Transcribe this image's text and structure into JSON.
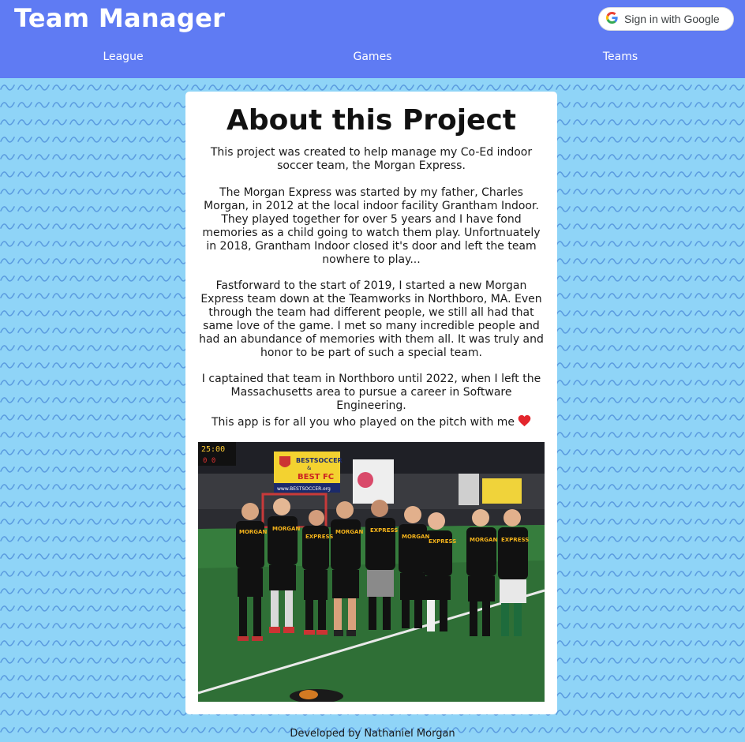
{
  "header": {
    "title": "Team Manager",
    "sign_in_label": "Sign in with Google",
    "nav": [
      "League",
      "Games",
      "Teams"
    ]
  },
  "about": {
    "title": "About this Project",
    "paragraphs": [
      "This project was created to help manage my Co-Ed indoor soccer team, the Morgan Express.",
      "The Morgan Express was started by my father, Charles Morgan, in 2012 at the local indoor facility Grantham Indoor. They played together for over 5 years and I have fond memories as a child going to watch them play. Unfortnuately in 2018, Grantham Indoor closed it's door and left the team nowhere to play...",
      "Fastforward to the start of 2019, I started a new Morgan Express team down at the Teamworks in Northboro, MA. Even through the team had different people, we still all had that same love of the game. I met so many incredible people and had an abundance of memories with them all. It was truly and honor to be part of such a special team.",
      "I captained that team in Northboro until 2022, when I left the Massachusetts area to pursue a career in Software Engineering.",
      "This app is for all you who played on the pitch with me"
    ],
    "heart_icon": "red-heart-icon",
    "photo": {
      "scoreboard": "25:00",
      "scores": "0  0",
      "banner_text": [
        "BESTSOCCER",
        "&",
        "BEST FC",
        "www.BESTSOCCER.org"
      ],
      "shirt_text": [
        "MORGAN",
        "EXPRESS"
      ]
    }
  },
  "footer": {
    "text": "Developed by Nathaniel Morgan"
  },
  "colors": {
    "header_bg": "#5f7bf3",
    "page_bg": "#8fd4f7",
    "wave": "#5c9de0",
    "card_bg": "#ffffff",
    "heart": "#e3262d"
  }
}
